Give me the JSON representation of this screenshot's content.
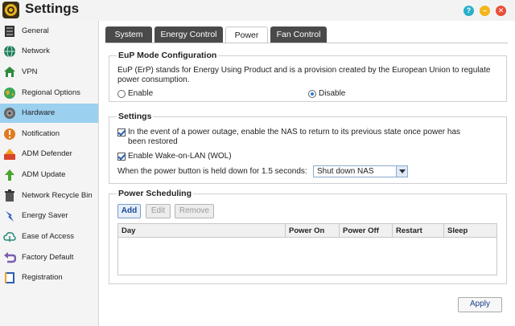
{
  "window": {
    "title": "Settings",
    "help": "?",
    "minimize": "–",
    "close": "✕"
  },
  "sidebar": {
    "items": [
      {
        "label": "General",
        "icon": "server-icon",
        "active": false
      },
      {
        "label": "Network",
        "icon": "globe-icon",
        "active": false
      },
      {
        "label": "VPN",
        "icon": "vpn-house-icon",
        "active": false
      },
      {
        "label": "Regional Options",
        "icon": "earth-icon",
        "active": false
      },
      {
        "label": "Hardware",
        "icon": "hardware-disc-icon",
        "active": true
      },
      {
        "label": "Notification",
        "icon": "alert-icon",
        "active": false
      },
      {
        "label": "ADM Defender",
        "icon": "defender-icon",
        "active": false
      },
      {
        "label": "ADM Update",
        "icon": "update-arrow-icon",
        "active": false
      },
      {
        "label": "Network Recycle Bin",
        "icon": "trash-icon",
        "active": false
      },
      {
        "label": "Energy Saver",
        "icon": "energy-bolt-icon",
        "active": false
      },
      {
        "label": "Ease of Access",
        "icon": "cloud-access-icon",
        "active": false
      },
      {
        "label": "Factory Default",
        "icon": "undo-arrow-icon",
        "active": false
      },
      {
        "label": "Registration",
        "icon": "registration-book-icon",
        "active": false
      }
    ]
  },
  "tabs": [
    {
      "label": "System",
      "active": false
    },
    {
      "label": "Energy Control",
      "active": false
    },
    {
      "label": "Power",
      "active": true
    },
    {
      "label": "Fan Control",
      "active": false
    }
  ],
  "eup": {
    "title": "EuP Mode Configuration",
    "description_line1": "EuP (ErP) stands for Energy Using Product and is a provision created by the European Union to regulate",
    "description_line2": "power consumption.",
    "enable_label": "Enable",
    "disable_label": "Disable",
    "selected": "Disable"
  },
  "settings": {
    "title": "Settings",
    "power_outage_line1": "In the event of a power outage, enable the NAS to return to its previous state once power has",
    "power_outage_line2": "been restored",
    "power_outage_checked": true,
    "wol_label": "Enable Wake-on-LAN (WOL)",
    "wol_checked": true,
    "power_button_label": "When the power button is held down for 1.5 seconds:",
    "power_button_value": "Shut down NAS"
  },
  "scheduling": {
    "title": "Power Scheduling",
    "add_label": "Add",
    "edit_label": "Edit",
    "remove_label": "Remove",
    "columns": [
      "Day",
      "Power On",
      "Power Off",
      "Restart",
      "Sleep"
    ]
  },
  "apply_label": "Apply",
  "colors": {
    "active_sidebar": "#9bd0ef",
    "tab_dark": "#4a4a4a",
    "help": "#27b0c9",
    "minimize": "#f2b51c",
    "close": "#e94e3b"
  }
}
